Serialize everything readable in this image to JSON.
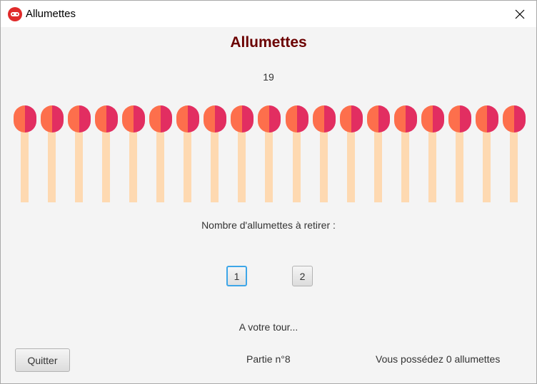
{
  "window": {
    "title": "Allumettes"
  },
  "game": {
    "heading": "Allumettes",
    "remaining_count": "19",
    "matches_shown": 19,
    "prompt": "Nombre d'allumettes à retirer :",
    "choices": [
      "1",
      "2"
    ],
    "selected_choice": "1",
    "status": "A votre tour...",
    "game_number": "Partie n°8",
    "player_matches": "Vous possédez 0 allumettes",
    "quit_label": "Quitter"
  },
  "colors": {
    "heading": "#6b0000",
    "match_head_left": "#fd6f4c",
    "match_head_right": "#e22e61",
    "match_stick": "#fed9b1",
    "focus_border": "#3da6e8"
  },
  "icons": {
    "app": "gamepad-icon",
    "close": "close-icon"
  }
}
